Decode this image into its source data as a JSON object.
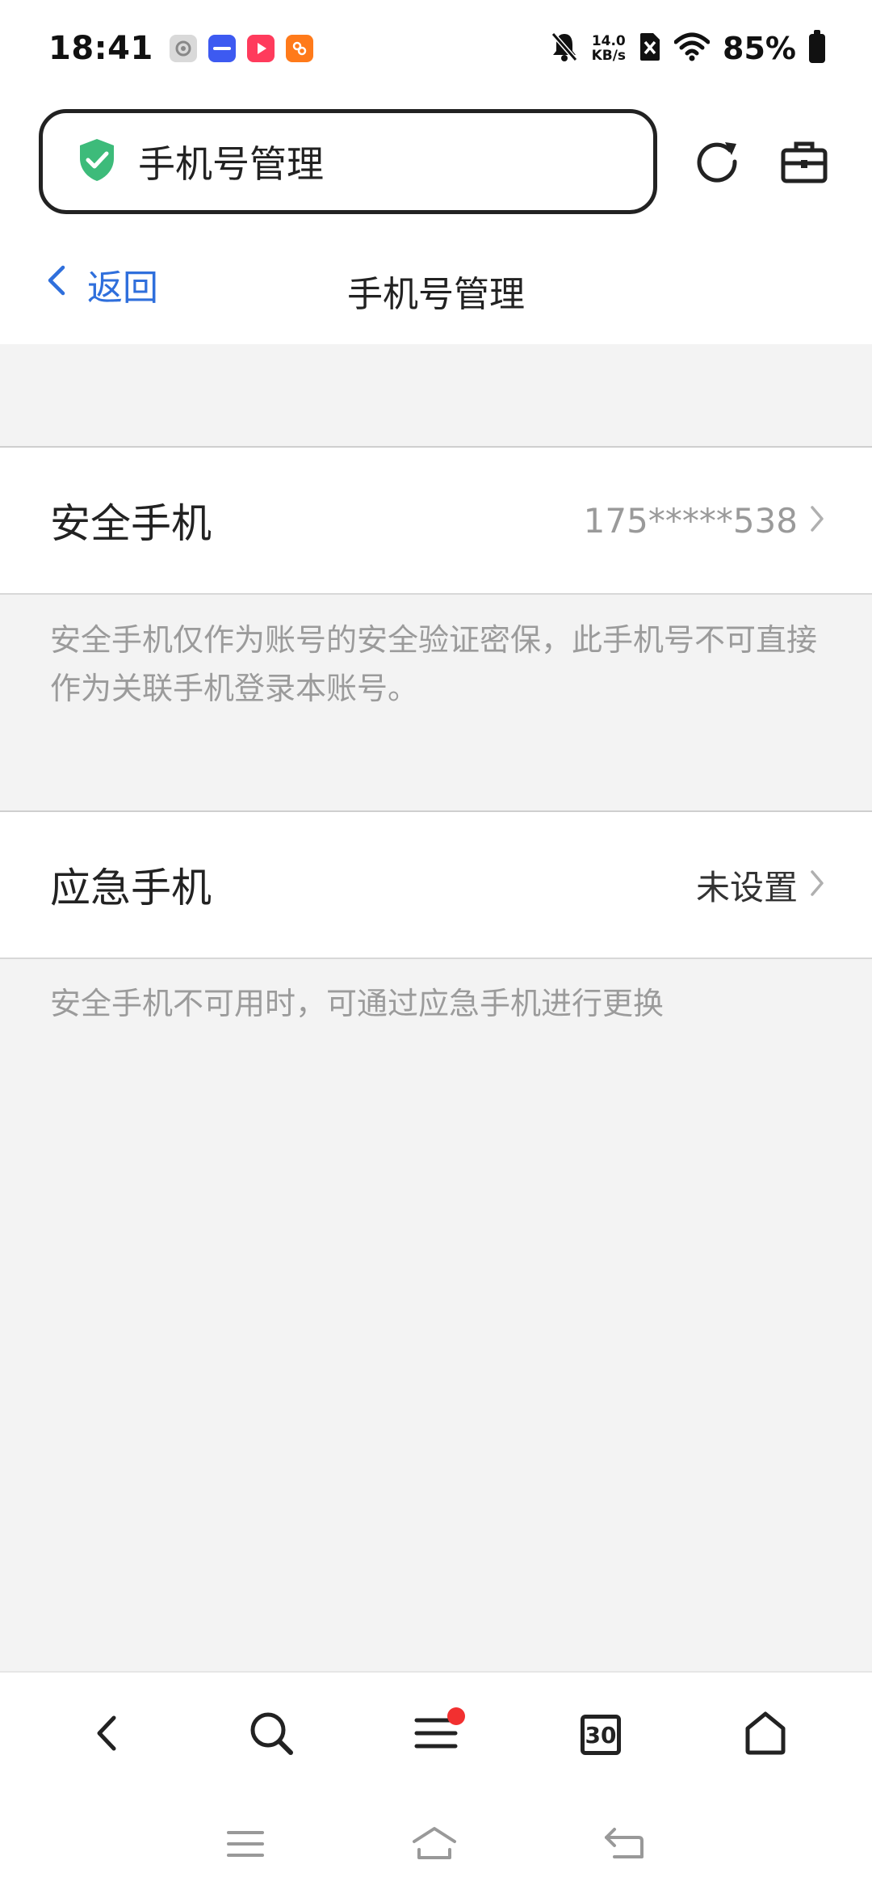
{
  "status_bar": {
    "time": "18:41",
    "net_speed_value": "14.0",
    "net_speed_unit": "KB/s",
    "battery": "85%",
    "icons": [
      "settings-app-icon",
      "vivo-app-icon",
      "video-app-icon",
      "shop-app-icon",
      "mute-bell-icon",
      "sim-x-icon",
      "wifi-icon",
      "battery-icon"
    ]
  },
  "browser": {
    "address_text": "手机号管理",
    "colors": {
      "shield": "#3dbb7a"
    }
  },
  "page": {
    "back_label": "返回",
    "title": "手机号管理"
  },
  "rows": [
    {
      "label": "安全手机",
      "value": "175*****538",
      "description": "安全手机仅作为账号的安全验证密保，此手机号不可直接作为关联手机登录本账号。"
    },
    {
      "label": "应急手机",
      "value": "未设置",
      "description": "安全手机不可用时，可通过应急手机进行更换"
    }
  ],
  "toolbar": {
    "tabs_count": "30"
  },
  "colors": {
    "link_blue": "#2f6fdc",
    "notification_red": "#f23030"
  }
}
